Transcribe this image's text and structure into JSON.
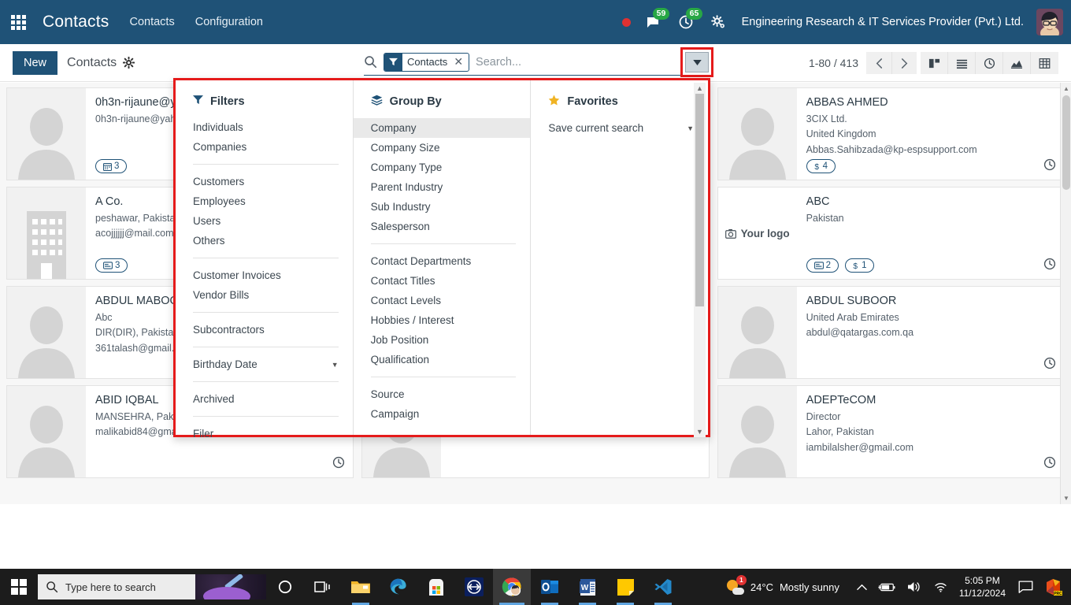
{
  "navbar": {
    "apps_icon": "apps-grid-icon",
    "brand": "Contacts",
    "menus": [
      {
        "label": "Contacts"
      },
      {
        "label": "Configuration"
      }
    ],
    "recording_dot": "record-dot-icon",
    "messages": {
      "icon": "chat-icon",
      "count": "59"
    },
    "activities": {
      "icon": "clock-activity-icon",
      "count": "65"
    },
    "settings_icon": "gears-icon",
    "company": "Engineering Research & IT Services Provider (Pvt.) Ltd.",
    "avatar": "user-avatar"
  },
  "control_panel": {
    "new_label": "New",
    "breadcrumb": "Contacts",
    "gear_icon": "gear-icon",
    "pager": {
      "range": "1-80 / 413",
      "prev_icon": "chevron-left-icon",
      "next_icon": "chevron-right-icon"
    },
    "views": [
      {
        "name": "kanban",
        "icon": "kanban-icon"
      },
      {
        "name": "list",
        "icon": "list-icon"
      },
      {
        "name": "activity",
        "icon": "clock-icon"
      },
      {
        "name": "graph",
        "icon": "chart-icon"
      },
      {
        "name": "pivot",
        "icon": "pivot-table-icon"
      }
    ]
  },
  "search": {
    "icon": "search-icon",
    "facets": [
      {
        "icon": "filter-icon",
        "label": "Contacts",
        "remove_icon": "close-icon"
      }
    ],
    "placeholder": "Search...",
    "value": "",
    "toggle_icon": "caret-down-icon",
    "highlight_color": "#e51b1b"
  },
  "dropdown": {
    "filters": {
      "title": "Filters",
      "icon": "filter-icon",
      "groups": [
        {
          "items": [
            {
              "label": "Individuals"
            },
            {
              "label": "Companies"
            }
          ]
        },
        {
          "items": [
            {
              "label": "Customers"
            },
            {
              "label": "Employees"
            },
            {
              "label": "Users"
            },
            {
              "label": "Others"
            }
          ]
        },
        {
          "items": [
            {
              "label": "Customer Invoices"
            },
            {
              "label": "Vendor Bills"
            }
          ]
        },
        {
          "items": [
            {
              "label": "Subcontractors"
            }
          ]
        },
        {
          "items": [
            {
              "label": "Birthday Date",
              "caret": "▼"
            }
          ]
        },
        {
          "items": [
            {
              "label": "Archived"
            }
          ]
        },
        {
          "items": [
            {
              "label": "Filer"
            }
          ]
        }
      ]
    },
    "group_by": {
      "title": "Group By",
      "icon": "layers-icon",
      "groups": [
        {
          "items": [
            {
              "label": "Company",
              "active": true
            },
            {
              "label": "Company Size"
            },
            {
              "label": "Company Type"
            },
            {
              "label": "Parent Industry"
            },
            {
              "label": "Sub Industry"
            },
            {
              "label": "Salesperson"
            }
          ]
        },
        {
          "items": [
            {
              "label": "Contact Departments"
            },
            {
              "label": "Contact Titles"
            },
            {
              "label": "Contact Levels"
            },
            {
              "label": "Hobbies / Interest"
            },
            {
              "label": "Job Position"
            },
            {
              "label": "Qualification"
            }
          ]
        },
        {
          "items": [
            {
              "label": "Source"
            },
            {
              "label": "Campaign"
            }
          ]
        }
      ]
    },
    "favorites": {
      "title": "Favorites",
      "icon": "star-icon",
      "groups": [
        {
          "items": [
            {
              "label": "Save current search",
              "caret": "▼"
            }
          ]
        }
      ]
    }
  },
  "kanban": {
    "column_left": [
      {
        "name": "0h3n-rijaune@y",
        "lines": [
          "0h3n-rijaune@yah"
        ],
        "badges": [
          {
            "icon": "calendar-icon",
            "text": "3"
          }
        ],
        "avatar": "person-placeholder",
        "clock": false
      },
      {
        "name": "A Co.",
        "lines": [
          "peshawar, Pakistan",
          "acojjjjjj@mail.com"
        ],
        "badges": [
          {
            "icon": "card-icon",
            "text": "3"
          }
        ],
        "avatar": "building-placeholder",
        "clock": false
      },
      {
        "name": "ABDUL MABOO",
        "lines": [
          "Abc",
          "DIR(DIR), Pakistan",
          "361talash@gmail.c"
        ],
        "badges": [],
        "avatar": "person-placeholder",
        "clock": false
      },
      {
        "name": "ABID IQBAL",
        "lines": [
          "MANSEHRA, Pakistan",
          "malikabid84@gmail.com"
        ],
        "badges": [],
        "avatar": "person-placeholder",
        "clock": true
      }
    ],
    "column_middle": [
      {
        "name": "",
        "lines": [],
        "badges": [],
        "avatar": "person-placeholder",
        "clock": false
      },
      {
        "name": "",
        "lines": [],
        "badges": [],
        "avatar": "person-placeholder",
        "clock": false
      },
      {
        "name": "",
        "lines": [],
        "badges": [],
        "avatar": "person-placeholder",
        "clock": false
      },
      {
        "name": "",
        "lines": [],
        "badges": [],
        "avatar": "person-placeholder",
        "clock": true
      }
    ],
    "column_right": [
      {
        "name": "ABBAS AHMED",
        "lines": [
          "3CIX Ltd.",
          "United Kingdom",
          "Abbas.Sahibzada@kp-espsupport.com"
        ],
        "badges": [
          {
            "icon": "dollar-icon",
            "text": "4"
          }
        ],
        "avatar": "person-placeholder",
        "clock": true
      },
      {
        "name": "ABC",
        "lines": [
          "Pakistan"
        ],
        "badges": [
          {
            "icon": "card-icon",
            "text": "2"
          },
          {
            "icon": "dollar-icon",
            "text": "1"
          }
        ],
        "avatar": "logo-placeholder",
        "logo_text": "Your logo",
        "clock": true
      },
      {
        "name": "ABDUL SUBOOR",
        "lines": [
          "United Arab Emirates",
          "abdul@qatargas.com.qa"
        ],
        "badges": [],
        "avatar": "person-placeholder",
        "clock": true
      },
      {
        "name": "ADEPTeCOM",
        "lines": [
          "Director",
          "Lahor, Pakistan",
          "iambilalsher@gmail.com"
        ],
        "badges": [],
        "avatar": "person-placeholder",
        "clock": true
      }
    ]
  },
  "taskbar": {
    "start_icon": "windows-start-icon",
    "search_placeholder": "Type here to search",
    "search_icon": "search-icon",
    "cortana_icon": "cortana-circle-icon",
    "taskview_icon": "task-view-icon",
    "apps": [
      {
        "name": "file-explorer",
        "open": true
      },
      {
        "name": "microsoft-edge",
        "open": false
      },
      {
        "name": "microsoft-store",
        "open": false
      },
      {
        "name": "teamviewer",
        "open": false
      },
      {
        "name": "google-chrome",
        "active": true
      },
      {
        "name": "microsoft-outlook",
        "open": true
      },
      {
        "name": "microsoft-word",
        "open": true
      },
      {
        "name": "sticky-notes",
        "open": true
      },
      {
        "name": "visual-studio-code",
        "open": true
      }
    ],
    "tray": {
      "weather_temp": "24°C",
      "weather_desc": "Mostly sunny",
      "weather_badge": "1",
      "chevron_icon": "show-hidden-icons-chevron",
      "battery_icon": "battery-icon",
      "volume_icon": "volume-icon",
      "network_icon": "wifi-icon",
      "time": "5:05 PM",
      "date": "11/12/2024",
      "notification_icon": "action-center-icon",
      "extra_icon": "office-prc-icon"
    }
  }
}
